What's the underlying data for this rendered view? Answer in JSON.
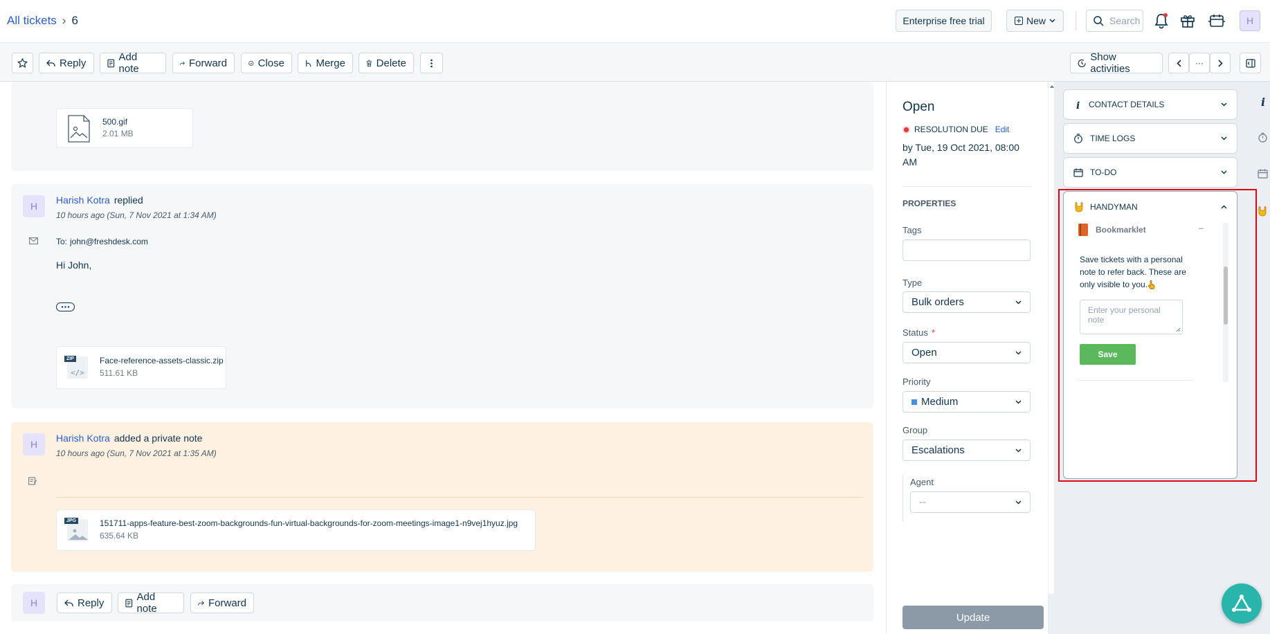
{
  "header": {
    "breadcrumb_link": "All tickets",
    "breadcrumb_sep": "›",
    "ticket_id": "6",
    "trial_label": "Enterprise free trial",
    "new_label": "New",
    "search_placeholder": "Search",
    "avatar_initial": "H"
  },
  "toolbar": {
    "reply": "Reply",
    "add_note": "Add note",
    "forward": "Forward",
    "close": "Close",
    "merge": "Merge",
    "delete": "Delete",
    "show_activities": "Show activities",
    "more_dots": "···"
  },
  "conversation": {
    "first_attachment": {
      "name": "500.gif",
      "size": "2.01 MB"
    },
    "reply": {
      "avatar": "H",
      "author": "Harish Kotra",
      "action": "replied",
      "time": "10 hours ago (Sun, 7 Nov 2021 at 1:34 AM)",
      "to_label": "To:",
      "to_value": "john@freshdesk.com",
      "body": "Hi John,",
      "attachment": {
        "name": "Face-reference-assets-classic.zip",
        "size": "511.61 KB",
        "badge": "ZIP"
      }
    },
    "note": {
      "avatar": "H",
      "author": "Harish Kotra",
      "action": "added a private note",
      "time": "10 hours ago (Sun, 7 Nov 2021 at 1:35 AM)",
      "attachment": {
        "name": "151711-apps-feature-best-zoom-backgrounds-fun-virtual-backgrounds-for-zoom-meetings-image1-n9vej1hyuz.jpg",
        "size": "635.64 KB",
        "badge": "JPG"
      }
    },
    "footer": {
      "avatar": "H",
      "reply": "Reply",
      "add_note": "Add note",
      "forward": "Forward"
    }
  },
  "properties": {
    "status_title": "Open",
    "resolution_label": "RESOLUTION DUE",
    "edit_label": "Edit",
    "due_text": "by Tue, 19 Oct 2021, 08:00 AM",
    "section_title": "PROPERTIES",
    "tags_label": "Tags",
    "type_label": "Type",
    "type_value": "Bulk orders",
    "status_label": "Status",
    "required_mark": "*",
    "status_value": "Open",
    "priority_label": "Priority",
    "priority_value": "Medium",
    "priority_color": "#4a90e2",
    "group_label": "Group",
    "group_value": "Escalations",
    "agent_label": "Agent",
    "agent_value": "--",
    "update_label": "Update"
  },
  "sidebar": {
    "contact_details": "CONTACT DETAILS",
    "time_logs": "TIME LOGS",
    "todo": "TO-DO",
    "handyman": "HANDYMAN",
    "bookmarklet_title": "Bookmarklet",
    "bookmarklet_collapse": "–",
    "bookmarklet_desc": "Save tickets with a personal note to refer back. These are only visible to you.",
    "note_placeholder": "Enter your personal note",
    "save_label": "Save"
  },
  "colors": {
    "link": "#2c5cc5",
    "note_bg": "#fef1e1",
    "save_green": "#5cb85c",
    "update_gray": "#8c9aa7",
    "highlight_red": "#e0000f",
    "fab": "#2ab5ac"
  }
}
